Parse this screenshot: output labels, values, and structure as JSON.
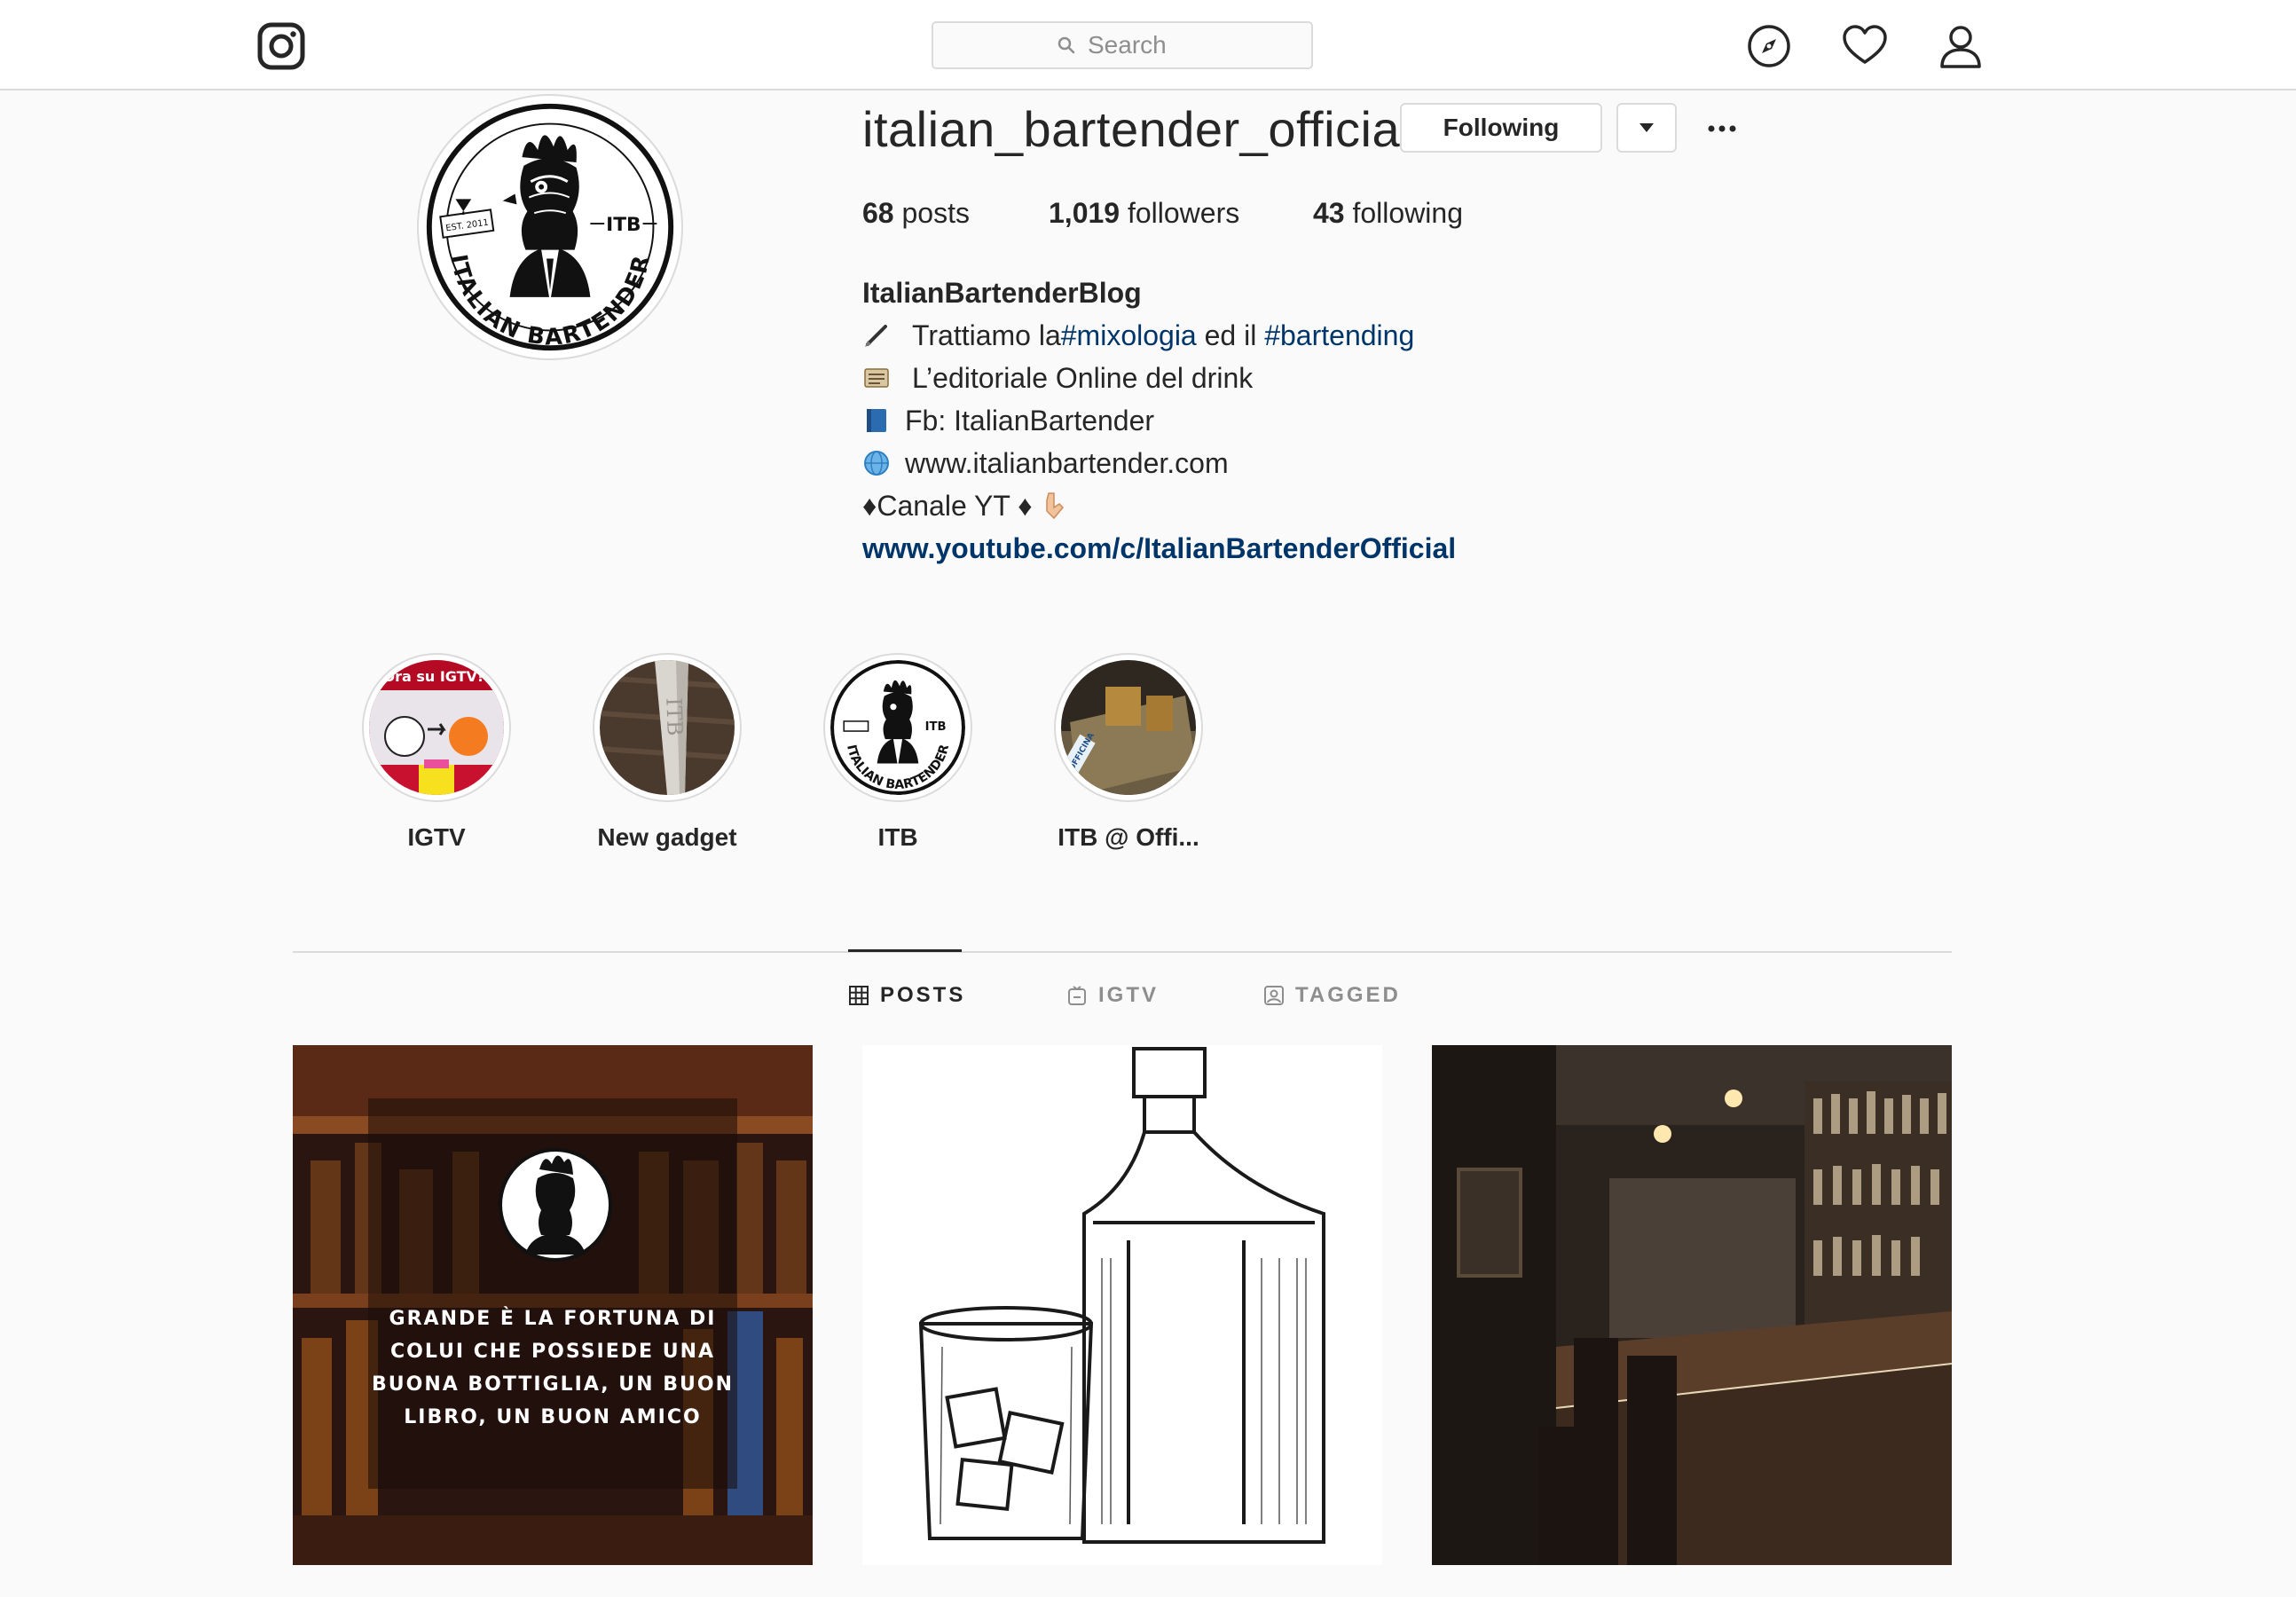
{
  "nav": {
    "search_placeholder": "Search"
  },
  "profile": {
    "username": "italian_bartender_official",
    "following_label": "Following",
    "stats": {
      "posts_count": "68",
      "posts_label": "posts",
      "followers_count": "1,019",
      "followers_label": "followers",
      "following_count": "43",
      "following_label": "following"
    },
    "bio": {
      "name": "ItalianBartenderBlog",
      "line1_prefix": "Trattiamo la ",
      "line1_tag1": "#mixologia",
      "line1_mid": " ed il ",
      "line1_tag2": "#bartending",
      "line2": "L’editoriale Online del drink",
      "line3": "Fb: ItalianBartender",
      "line4": "www.italianbartender.com",
      "line5": "♦Canale YT ♦",
      "link": "www.youtube.com/c/ItalianBartenderOfficial"
    },
    "logo_text": {
      "itb": "ITB",
      "est": "EST. 2011",
      "brand": "ITALIAN BARTENDER"
    }
  },
  "highlights": [
    {
      "label": "IGTV",
      "banner": "Ora su IGTV!!"
    },
    {
      "label": "New gadget",
      "engraving": "ITB"
    },
    {
      "label": "ITB"
    },
    {
      "label": "ITB @ Offi...",
      "sticker": "#OFFICINA"
    }
  ],
  "tabs": [
    {
      "label": "POSTS",
      "active": true
    },
    {
      "label": "IGTV",
      "active": false
    },
    {
      "label": "TAGGED",
      "active": false
    }
  ],
  "posts": [
    {
      "quote": [
        "GRANDE È LA FORTUNA DI",
        "COLUI CHE POSSIEDE UNA",
        "BUONA BOTTIGLIA, UN BUON",
        "LIBRO, UN BUON AMICO"
      ]
    },
    {},
    {}
  ],
  "colors": {
    "text": "#262626",
    "link": "#003569",
    "border": "#dbdbdb",
    "background": "#fafafa",
    "secondary": "#8e8e8e"
  },
  "icons": {
    "logo": "instagram-logo-icon",
    "search": "search-icon",
    "explore": "compass-icon",
    "activity": "heart-icon",
    "profile": "user-icon",
    "dropdown": "caret-down-icon",
    "more": "ellipsis-icon",
    "posts_tab": "grid-icon",
    "igtv_tab": "tv-icon",
    "tagged_tab": "tag-user-icon"
  }
}
